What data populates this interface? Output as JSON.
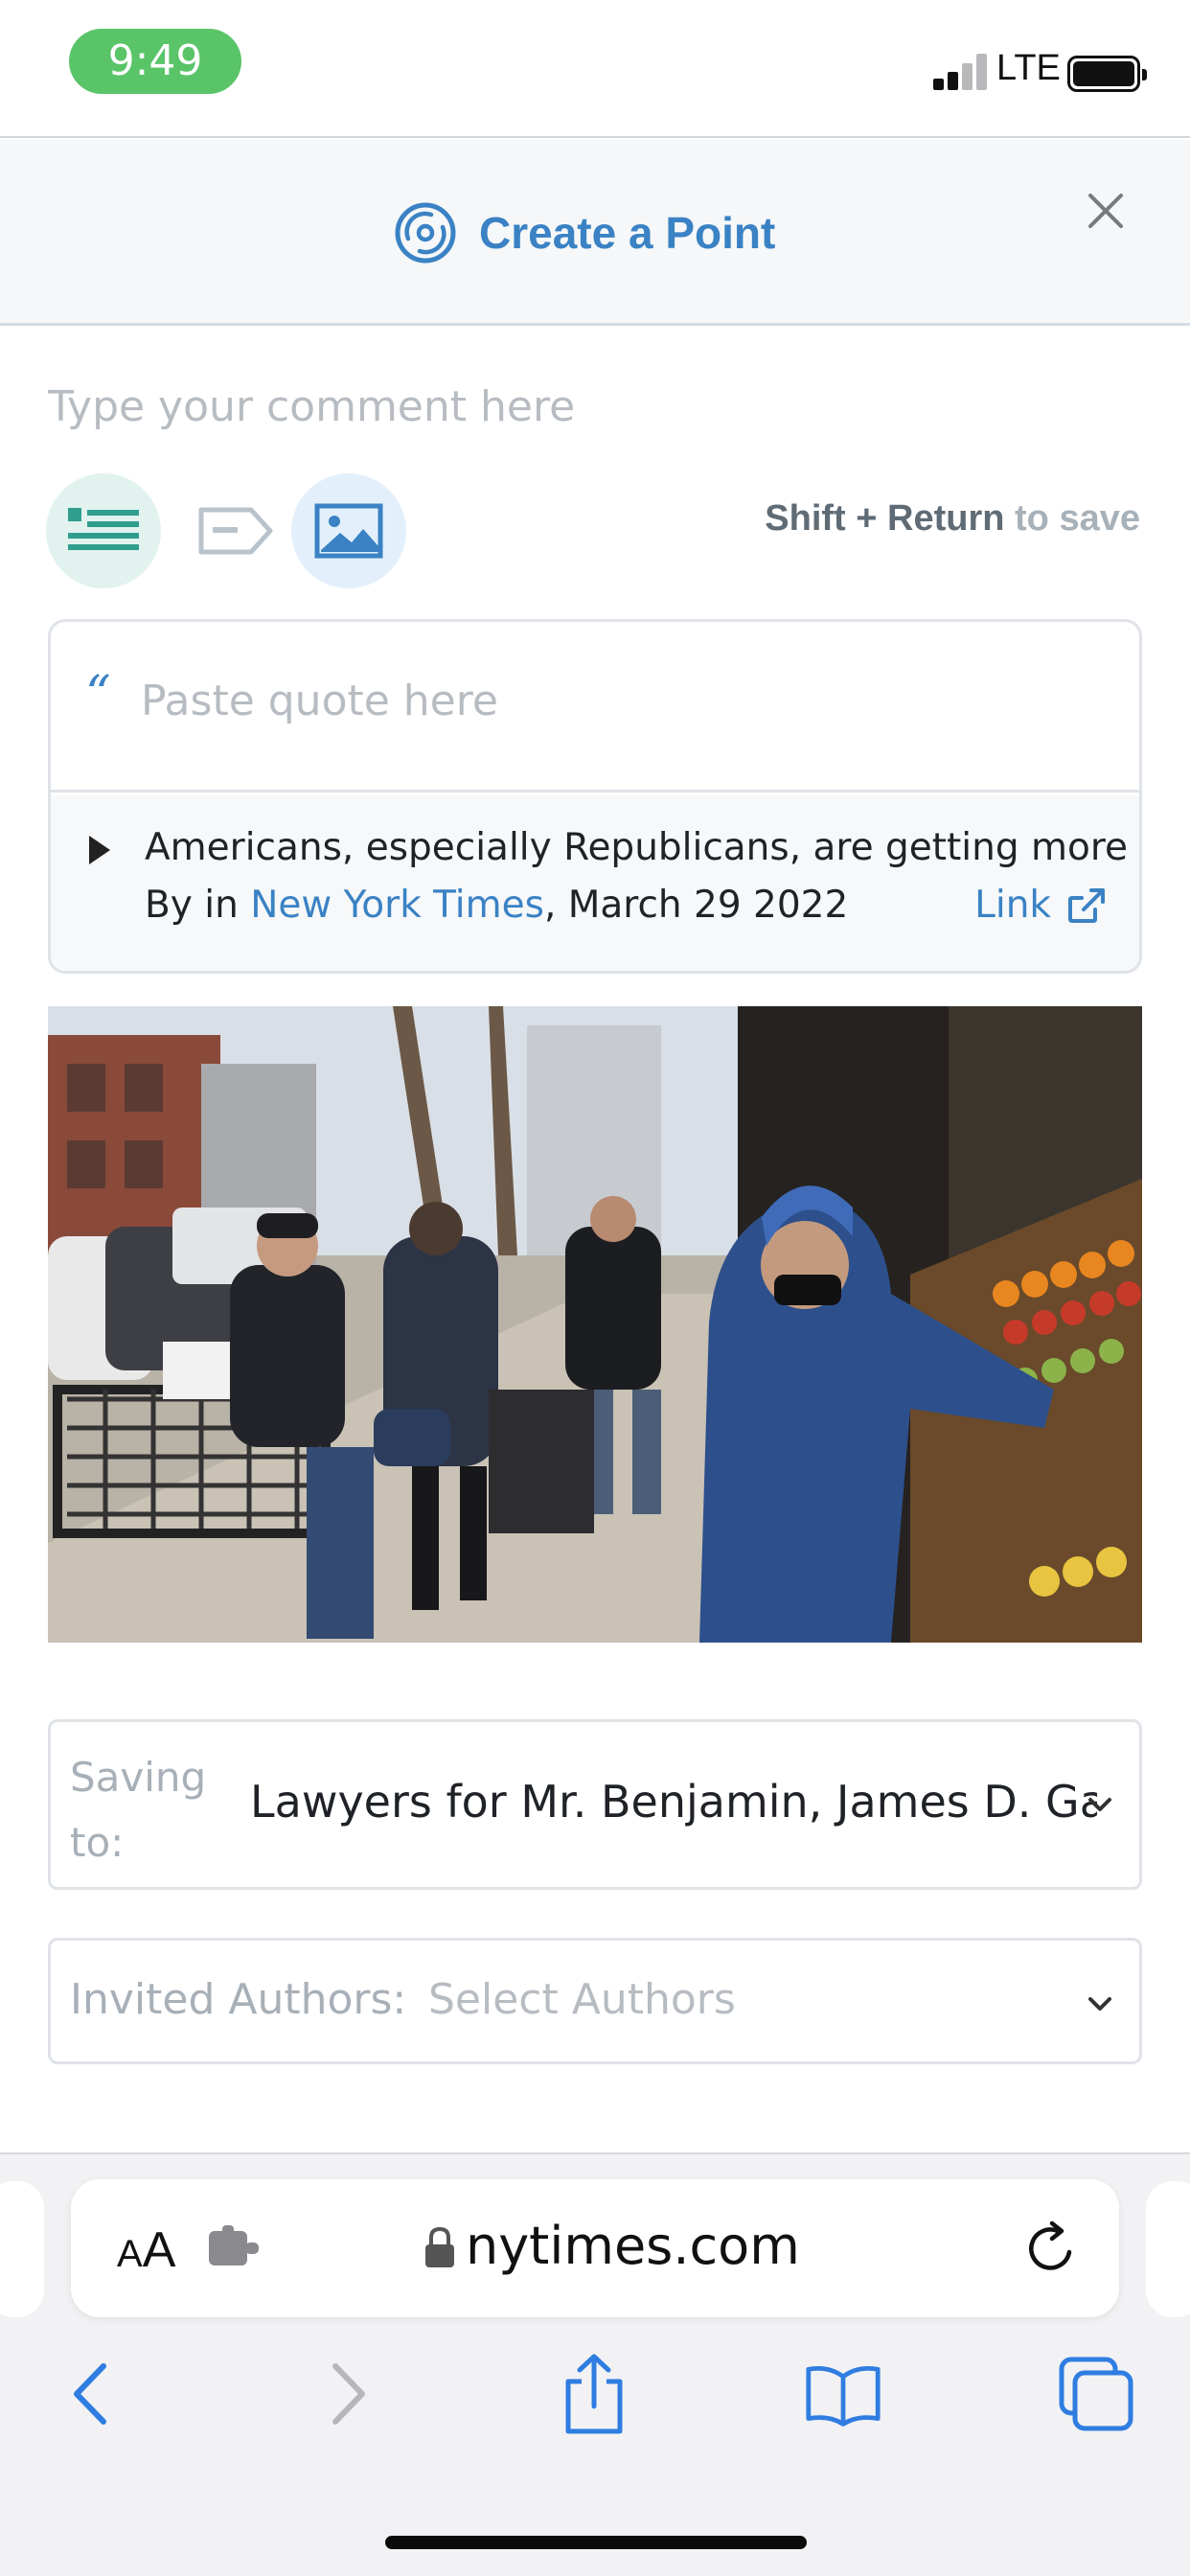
{
  "status_bar": {
    "time": "9:49",
    "network": "LTE",
    "signal_bars_active": 2,
    "signal_bars_total": 4
  },
  "header": {
    "title": "Create a Point",
    "icon": "point-target-icon",
    "close_icon": "close-icon",
    "accent_color": "#3a82c4"
  },
  "composer": {
    "comment_placeholder": "Type your comment here",
    "tools": [
      {
        "name": "quote-tool",
        "icon": "quote-text-icon",
        "active": true
      },
      {
        "name": "tag-tool",
        "icon": "tag-icon",
        "active": false
      },
      {
        "name": "image-tool",
        "icon": "image-icon",
        "active": true
      }
    ],
    "save_hint_keys": "Shift + Return",
    "save_hint_text": " to save"
  },
  "quote": {
    "mark": "“",
    "placeholder": "Paste quote here",
    "source": {
      "title": "Americans, especially Republicans, are getting more wor",
      "by_prefix": "By in ",
      "publication": "New York Times",
      "date_text": ", March 29 2022",
      "link_label": "Link"
    }
  },
  "image": {
    "alt_icon": "street-photo"
  },
  "saving": {
    "label": "Saving to:",
    "value": "Lawyers for Mr. Benjamin, James D. Gatt"
  },
  "authors": {
    "label": "Invited Authors:",
    "placeholder": "Select Authors"
  },
  "browser": {
    "text_size_small": "A",
    "text_size_large": "A",
    "url": "nytimes.com",
    "nav": [
      "back-icon",
      "forward-icon",
      "share-icon",
      "bookmarks-icon",
      "tabs-icon"
    ]
  }
}
